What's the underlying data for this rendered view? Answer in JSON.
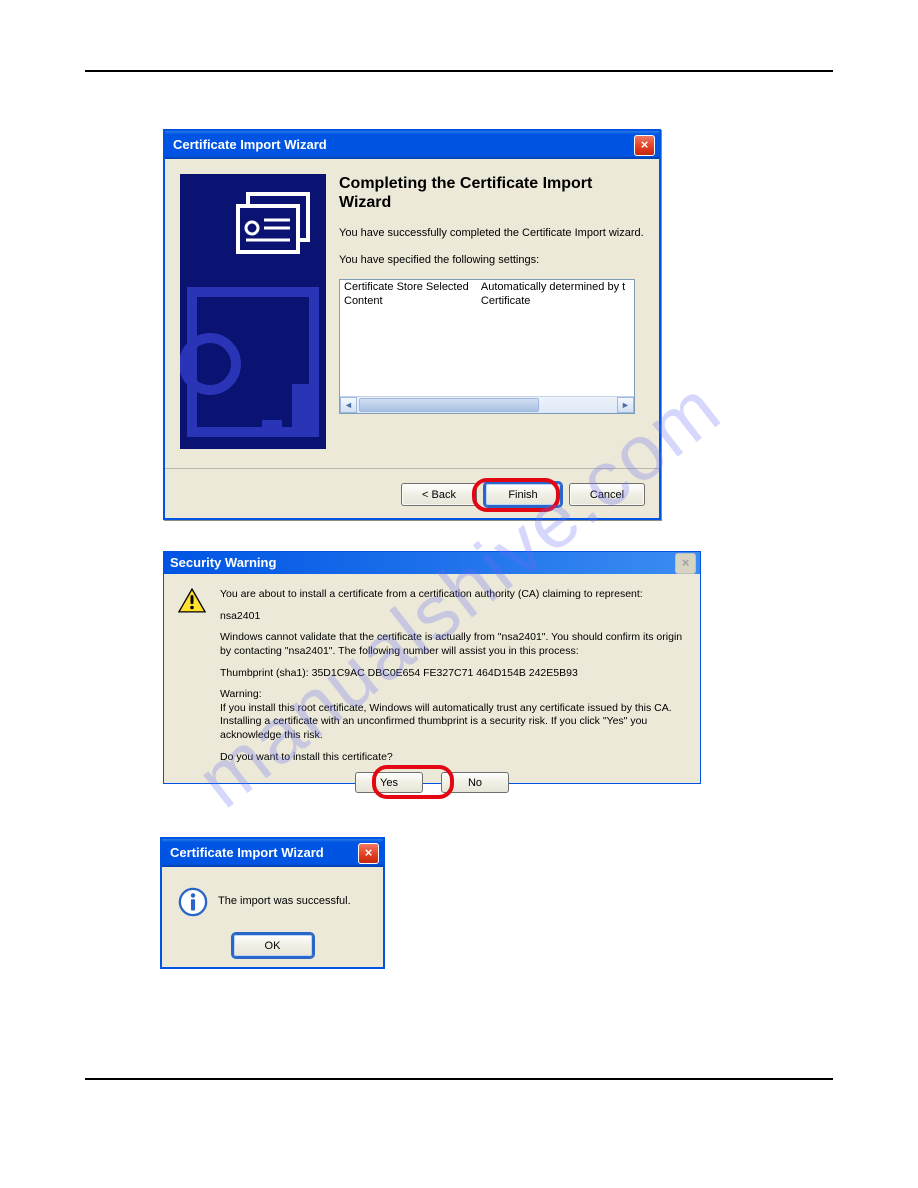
{
  "watermark": "manualshive.com",
  "dialog1": {
    "title": "Certificate Import Wizard",
    "heading": "Completing the Certificate Import Wizard",
    "success_text": "You have successfully completed the Certificate Import wizard.",
    "settings_label": "You have specified the following settings:",
    "settings_rows": [
      {
        "label": "Certificate Store Selected",
        "value": "Automatically determined by t"
      },
      {
        "label": "Content",
        "value": "Certificate"
      }
    ],
    "buttons": {
      "back": "< Back",
      "finish": "Finish",
      "cancel": "Cancel"
    }
  },
  "dialog2": {
    "title": "Security Warning",
    "line1": "You are about to install a certificate from a certification authority (CA) claiming to represent:",
    "ca_name": "nsa2401",
    "line2": "Windows cannot validate that the certificate is actually from \"nsa2401\". You should confirm its origin by contacting \"nsa2401\". The following number will assist you in this process:",
    "thumbprint": "Thumbprint (sha1): 35D1C9AC DBC0E654 FE327C71 464D154B 242E5B93",
    "warning_label": "Warning:",
    "warning_text": "If you install this root certificate, Windows will automatically trust any certificate issued by this CA. Installing a certificate with an unconfirmed thumbprint is a security risk. If you click \"Yes\" you acknowledge this risk.",
    "prompt": "Do you want to install this certificate?",
    "buttons": {
      "yes": "Yes",
      "no": "No"
    }
  },
  "dialog3": {
    "title": "Certificate Import Wizard",
    "message": "The import was successful.",
    "buttons": {
      "ok": "OK"
    }
  }
}
